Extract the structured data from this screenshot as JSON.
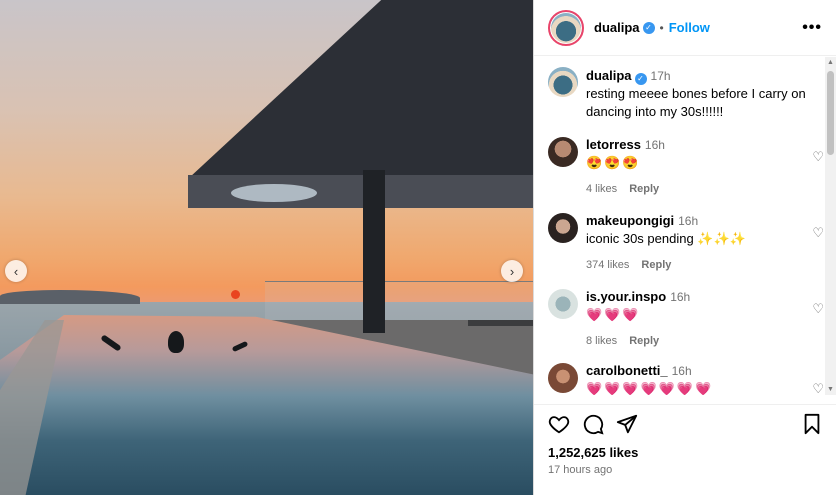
{
  "post": {
    "username": "dualipa",
    "follow_label": "Follow",
    "separator": "•",
    "more_label": "•••",
    "caption_user": "dualipa",
    "caption_time": "17h",
    "caption_text": "resting meeee bones before I carry on dancing into my 30s!!!!!!",
    "likes": "1,252,625 likes",
    "posted_ago": "17 hours ago"
  },
  "nav": {
    "prev": "‹",
    "next": "›"
  },
  "comments": [
    {
      "user": "letorress",
      "time": "16h",
      "text": "😍😍😍",
      "likes": "4 likes",
      "reply": "Reply"
    },
    {
      "user": "makeupongigi",
      "time": "16h",
      "text": "iconic 30s pending ✨✨✨",
      "likes": "374 likes",
      "reply": "Reply"
    },
    {
      "user": "is.your.inspo",
      "time": "16h",
      "text": "💗💗💗",
      "likes": "8 likes",
      "reply": "Reply"
    },
    {
      "user": "carolbonetti_",
      "time": "16h",
      "text": "💗💗💗💗💗💗💗",
      "likes": "",
      "reply": ""
    }
  ],
  "icons": {
    "like": "heart-icon",
    "comment": "comment-icon",
    "share": "share-icon",
    "save": "bookmark-icon"
  },
  "colors": {
    "follow": "#0095f6",
    "verified": "#3897f0"
  }
}
